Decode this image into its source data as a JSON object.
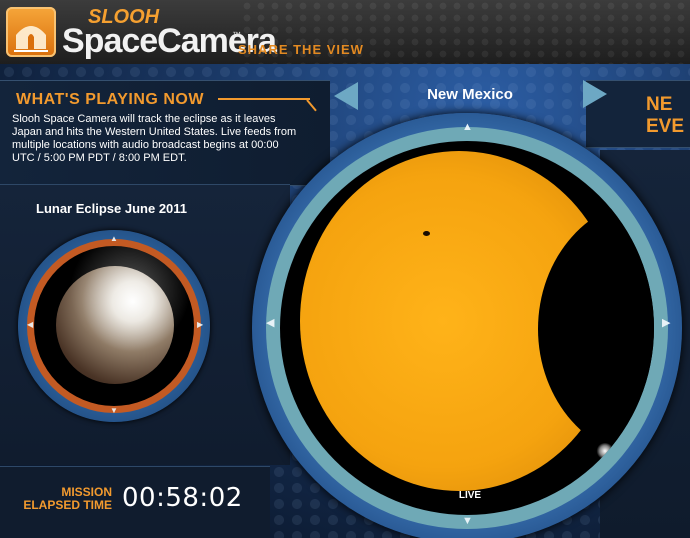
{
  "header": {
    "brand_top": "SLOOH",
    "brand_main": "SpaceCamera",
    "trademark": "™",
    "tagline": "SHARE THE VIEW"
  },
  "now_playing": {
    "heading": "WHAT'S PLAYING NOW",
    "description": "Slooh Space Camera will track the eclipse as it leaves Japan and hits the Western United States. Live feeds from multiple locations with audio broadcast begins at 00:00 UTC / 5:00 PM PDT / 8:00 PM EDT."
  },
  "thumbnail": {
    "title": "Lunar Eclipse June 2011"
  },
  "viewer": {
    "location": "New Mexico",
    "status": "LIVE"
  },
  "next_event": {
    "label_line1": "NE",
    "label_line2": "EVE"
  },
  "mission": {
    "label_line1": "MISSION",
    "label_line2": "ELAPSED TIME",
    "elapsed": "00:58:02"
  },
  "glyphs": {
    "up": "▲",
    "down": "▼",
    "left": "◀",
    "right": "▶"
  },
  "colors": {
    "accent_orange": "#f29a2e",
    "sun": "#f5a30f",
    "ring_teal": "#6fa9b6",
    "ring_blue": "#3f78b9"
  },
  "icons": {
    "logo": "observatory-logo-icon",
    "prev": "prev-arrow-icon",
    "next": "next-arrow-icon"
  }
}
